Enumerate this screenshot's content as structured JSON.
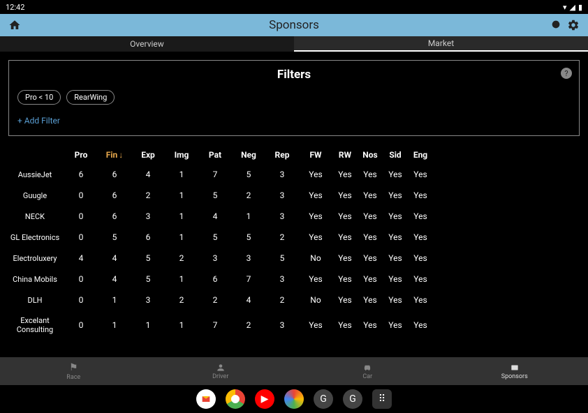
{
  "status": {
    "time": "12:42"
  },
  "appBar": {
    "title": "Sponsors"
  },
  "tabs": [
    {
      "label": "Overview",
      "active": false
    },
    {
      "label": "Market",
      "active": true
    }
  ],
  "filters": {
    "title": "Filters",
    "chips": [
      "Pro < 10",
      "RearWing"
    ],
    "addLabel": "+ Add Filter"
  },
  "table": {
    "headers": [
      "Pro",
      "Fin",
      "Exp",
      "Img",
      "Pat",
      "Neg",
      "Rep",
      "FW",
      "RW",
      "Nos",
      "Sid",
      "Eng"
    ],
    "sortCol": "Fin",
    "rows": [
      {
        "name": "AussieJet",
        "vals": [
          "6",
          "6",
          "4",
          "1",
          "7",
          "5",
          "3",
          "Yes",
          "Yes",
          "Yes",
          "Yes",
          "Yes"
        ]
      },
      {
        "name": "Guugle",
        "vals": [
          "0",
          "6",
          "2",
          "1",
          "5",
          "2",
          "3",
          "Yes",
          "Yes",
          "Yes",
          "Yes",
          "Yes"
        ]
      },
      {
        "name": "NECK",
        "vals": [
          "0",
          "6",
          "3",
          "1",
          "4",
          "1",
          "3",
          "Yes",
          "Yes",
          "Yes",
          "Yes",
          "Yes"
        ]
      },
      {
        "name": "GL Electronics",
        "vals": [
          "0",
          "5",
          "6",
          "1",
          "5",
          "5",
          "2",
          "Yes",
          "Yes",
          "Yes",
          "Yes",
          "Yes"
        ]
      },
      {
        "name": "Electroluxery",
        "vals": [
          "4",
          "4",
          "5",
          "2",
          "3",
          "3",
          "5",
          "No",
          "Yes",
          "Yes",
          "Yes",
          "Yes"
        ]
      },
      {
        "name": "China Mobils",
        "vals": [
          "0",
          "4",
          "5",
          "1",
          "6",
          "7",
          "3",
          "Yes",
          "Yes",
          "Yes",
          "Yes",
          "Yes"
        ]
      },
      {
        "name": "DLH",
        "vals": [
          "0",
          "1",
          "3",
          "2",
          "2",
          "4",
          "2",
          "No",
          "Yes",
          "Yes",
          "Yes",
          "Yes"
        ]
      },
      {
        "name": "Excelant Consulting",
        "vals": [
          "0",
          "1",
          "1",
          "1",
          "7",
          "2",
          "3",
          "Yes",
          "Yes",
          "Yes",
          "Yes",
          "Yes"
        ]
      }
    ]
  },
  "bottomNav": [
    {
      "label": "Race",
      "icon": "flag"
    },
    {
      "label": "Driver",
      "icon": "person"
    },
    {
      "label": "Car",
      "icon": "car"
    },
    {
      "label": "Sponsors",
      "icon": "sponsors",
      "active": true
    }
  ]
}
